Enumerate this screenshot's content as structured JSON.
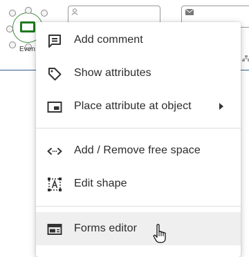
{
  "background": {
    "event_label": "Even",
    "side_text": "y"
  },
  "menu": {
    "items": [
      {
        "label": "Add comment",
        "icon": "comment-icon"
      },
      {
        "label": "Show attributes",
        "icon": "tag-icon"
      },
      {
        "label": "Place attribute at object",
        "icon": "picture-in-picture-icon",
        "has_submenu": true
      },
      {
        "label": "Add / Remove free space",
        "icon": "free-space-icon"
      },
      {
        "label": "Edit shape",
        "icon": "edit-shape-icon"
      },
      {
        "label": "Forms editor",
        "icon": "forms-editor-icon",
        "hovered": true
      }
    ]
  },
  "colors": {
    "event_green": "#1f7a1f",
    "menu_hover": "#efefef",
    "connector_blue": "#2e5d86"
  }
}
